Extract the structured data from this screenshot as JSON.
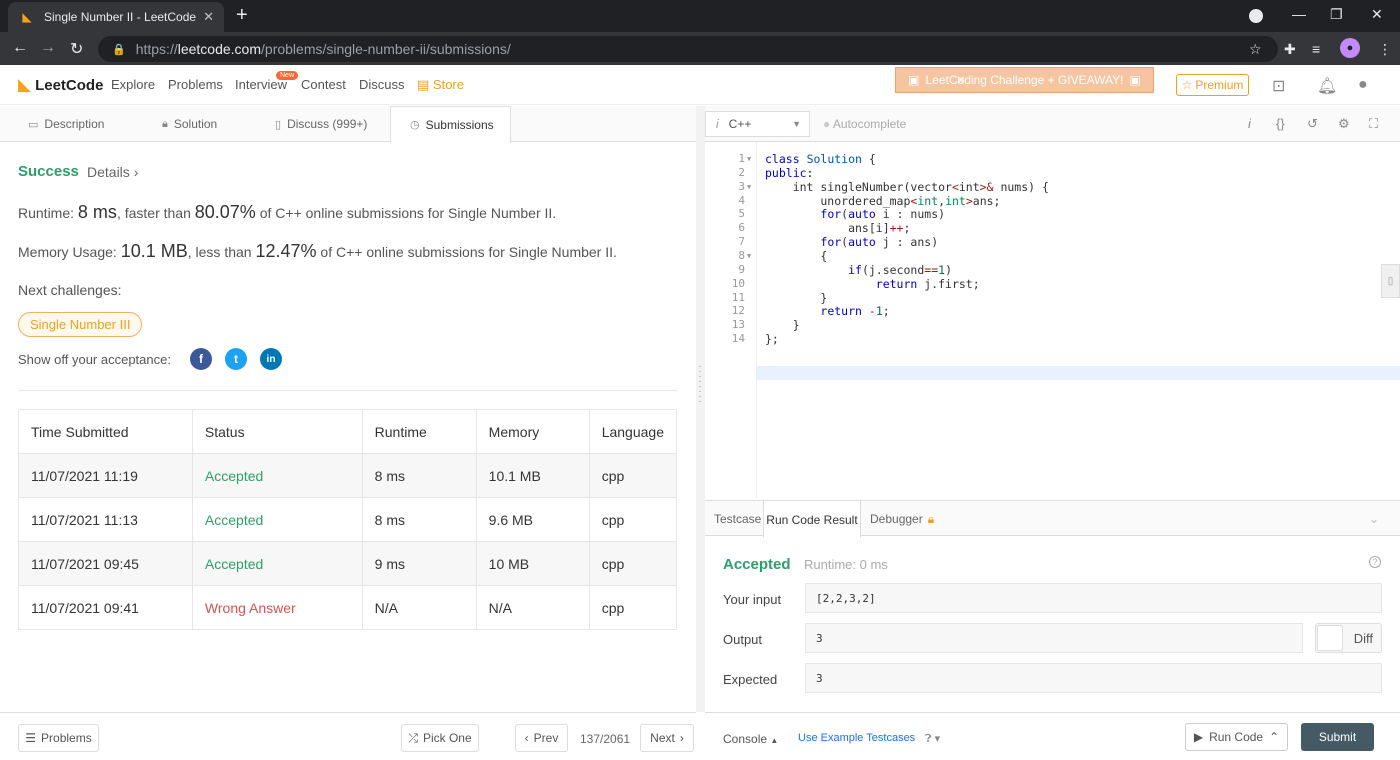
{
  "browser": {
    "tab_title": "Single Number II - LeetCode",
    "url_scheme": "https://",
    "url_host": "leetcode.com",
    "url_path": "/problems/single-number-ii/submissions/"
  },
  "header": {
    "logo_text": "LeetCode",
    "nav": [
      "Explore",
      "Problems",
      "Interview",
      "Contest",
      "Discuss",
      "Store"
    ],
    "new_badge": "New",
    "challenge_banner": "LeetCoding Challenge + GIVEAWAY!",
    "premium": "Premium"
  },
  "left_tabs": [
    "Description",
    "Solution",
    "Discuss (999+)",
    "Submissions"
  ],
  "result": {
    "status": "Success",
    "details": "Details",
    "details_arrow": "›",
    "runtime_label": "Runtime:",
    "runtime_value": "8 ms",
    "runtime_mid": ", faster than",
    "runtime_pct": "80.07%",
    "runtime_tail": "of C++ online submissions for Single Number II.",
    "memory_label": "Memory Usage:",
    "memory_value": "10.1 MB",
    "memory_mid": ", less than",
    "memory_pct": "12.47%",
    "memory_tail": "of C++ online submissions for Single Number II.",
    "next_challenges": "Next challenges:",
    "challenge_pill": "Single Number III",
    "show_off": "Show off your acceptance:"
  },
  "submissions": {
    "headers": [
      "Time Submitted",
      "Status",
      "Runtime",
      "Memory",
      "Language"
    ],
    "rows": [
      [
        "11/07/2021 11:19",
        "Accepted",
        "8 ms",
        "10.1 MB",
        "cpp"
      ],
      [
        "11/07/2021 11:13",
        "Accepted",
        "8 ms",
        "9.6 MB",
        "cpp"
      ],
      [
        "11/07/2021 09:45",
        "Accepted",
        "9 ms",
        "10 MB",
        "cpp"
      ],
      [
        "11/07/2021 09:41",
        "Wrong Answer",
        "N/A",
        "N/A",
        "cpp"
      ]
    ]
  },
  "left_bottom": {
    "problems": "Problems",
    "pick_one": "Pick One",
    "prev": "Prev",
    "pager": "137/2061",
    "next": "Next"
  },
  "editor": {
    "language": "C++",
    "lang_prefix": "i",
    "autocomplete": "Autocomplete",
    "line_numbers": [
      "1",
      "2",
      "3",
      "4",
      "5",
      "6",
      "7",
      "8",
      "9",
      "10",
      "11",
      "12",
      "13",
      "14"
    ],
    "code_lines": [
      "class Solution {",
      "public:",
      "    int singleNumber(vector<int>& nums) {",
      "        unordered_map<int,int>ans;",
      "        for(auto i : nums)",
      "            ans[i]++;",
      "        for(auto j : ans)",
      "        {",
      "            if(j.second==1)",
      "                return j.first;",
      "        }",
      "        return -1;",
      "    }",
      "};"
    ]
  },
  "run_result": {
    "tabs": [
      "Testcase",
      "Run Code Result",
      "Debugger"
    ],
    "status": "Accepted",
    "runtime": "Runtime: 0 ms",
    "your_input_label": "Your input",
    "your_input": "[2,2,3,2]",
    "output_label": "Output",
    "output": "3",
    "expected_label": "Expected",
    "expected": "3",
    "diff": "Diff"
  },
  "right_bottom": {
    "console": "Console",
    "use_example": "Use Example Testcases",
    "run_code": "Run Code",
    "submit": "Submit"
  },
  "colors": {
    "accent_orange": "#ffa116",
    "success_green": "#2e9e6e",
    "error_red": "#d9534f",
    "submit_bg": "#455a64"
  }
}
